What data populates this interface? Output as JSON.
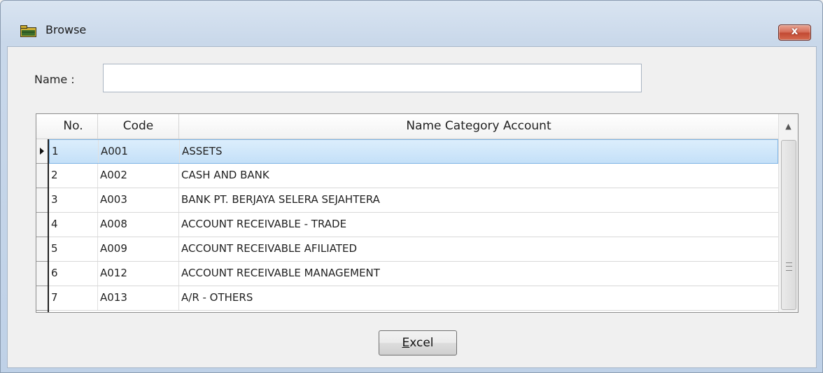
{
  "window": {
    "title": "Browse",
    "close_label": "x"
  },
  "filter": {
    "name_label": "Name :",
    "name_value": ""
  },
  "grid": {
    "columns": [
      "No.",
      "Code",
      "Name Category Account"
    ],
    "rows": [
      {
        "no": "1",
        "code": "A001",
        "name": "ASSETS"
      },
      {
        "no": "2",
        "code": "A002",
        "name": "CASH AND BANK"
      },
      {
        "no": "3",
        "code": "A003",
        "name": "BANK PT. BERJAYA SELERA SEJAHTERA"
      },
      {
        "no": "4",
        "code": "A008",
        "name": "ACCOUNT RECEIVABLE  - TRADE"
      },
      {
        "no": "5",
        "code": "A009",
        "name": "ACCOUNT RECEIVABLE AFILIATED"
      },
      {
        "no": "6",
        "code": "A012",
        "name": "ACCOUNT RECEIVABLE MANAGEMENT"
      },
      {
        "no": "7",
        "code": "A013",
        "name": "A/R - OTHERS"
      }
    ],
    "selected_row": 0
  },
  "actions": {
    "excel_first": "E",
    "excel_rest": "xcel"
  },
  "icons": {
    "title": "folder-icon",
    "close": "close-icon",
    "scroll_up": "scroll-up-arrow-icon",
    "row_indicator": "current-row-arrow-icon"
  },
  "colors": {
    "selection": "#c4e0f8",
    "close_button": "#c24a33"
  }
}
